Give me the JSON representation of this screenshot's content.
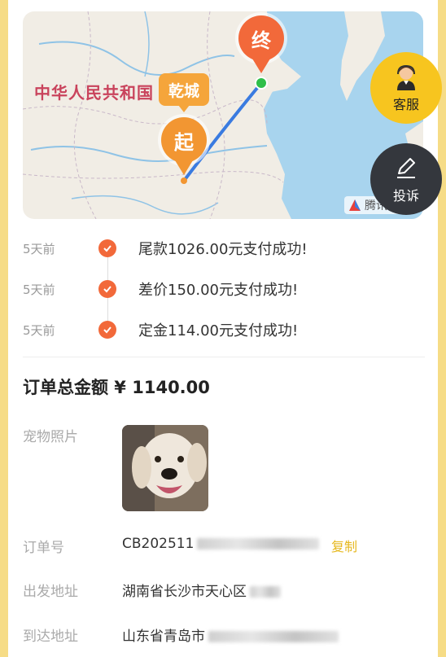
{
  "map": {
    "country_label": "中华人民共和国",
    "city_tag": "乾城",
    "start_pin": "起",
    "end_pin": "终",
    "logo_text": "腾讯地图"
  },
  "floating": {
    "service_label": "客服",
    "complaint_label": "投诉"
  },
  "timeline": [
    {
      "time": "5天前",
      "text": "尾款1026.00元支付成功!"
    },
    {
      "time": "5天前",
      "text": "差价150.00元支付成功!"
    },
    {
      "time": "5天前",
      "text": "定金114.00元支付成功!"
    }
  ],
  "order": {
    "total_label": "订单总金额 ¥ 1140.00",
    "pet_photo_label": "宠物照片",
    "order_no_label": "订单号",
    "order_no_value": "CB202511",
    "copy_label": "复制",
    "from_label": "出发地址",
    "from_value": "湖南省长沙市天心区",
    "to_label": "到达地址",
    "to_value": "山东省青岛市"
  },
  "colors": {
    "accent_orange": "#f2693a",
    "accent_yellow": "#f7c51f",
    "route_blue": "#3a7be0"
  }
}
